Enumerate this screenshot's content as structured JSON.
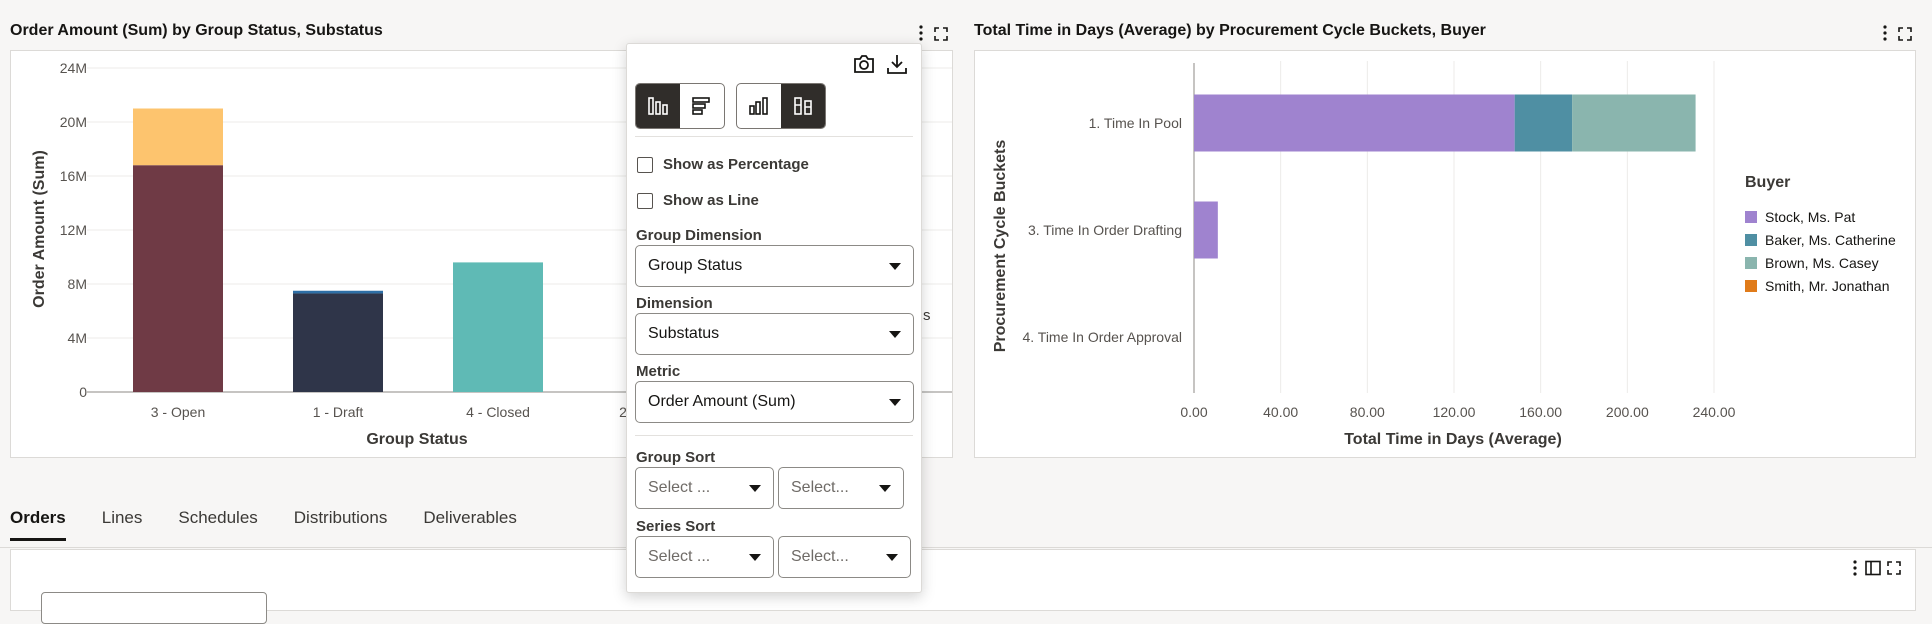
{
  "left_chart": {
    "title": "Order Amount (Sum) by Group Status, Substatus",
    "xlabel": "Group Status",
    "ylabel": "Order Amount (Sum)",
    "yticks": [
      "24M",
      "20M",
      "16M",
      "12M",
      "8M",
      "4M",
      "0"
    ],
    "categories": [
      "3 - Open",
      "1 - Draft",
      "4 - Closed",
      "2"
    ],
    "partial_legend_text": "s"
  },
  "right_chart": {
    "title": "Total Time in Days (Average) by Procurement Cycle Buckets, Buyer",
    "xlabel": "Total Time in Days (Average)",
    "ylabel": "Procurement Cycle Buckets",
    "xticks": [
      "0.00",
      "40.00",
      "80.00",
      "120.00",
      "160.00",
      "200.00",
      "240.00"
    ],
    "categories": [
      "1. Time In Pool",
      "3. Time In Order Drafting",
      "4. Time In Order Approval"
    ],
    "legend_title": "Buyer",
    "legend": [
      {
        "name": "Stock, Ms. Pat",
        "color": "#9f83cf"
      },
      {
        "name": "Baker, Ms. Catherine",
        "color": "#4f8fa3"
      },
      {
        "name": "Brown, Ms. Casey",
        "color": "#8ab5ae"
      },
      {
        "name": "Smith, Mr. Jonathan",
        "color": "#e07b1a"
      }
    ]
  },
  "chart_data": [
    {
      "type": "bar",
      "title": "Order Amount (Sum) by Group Status, Substatus",
      "xlabel": "Group Status",
      "ylabel": "Order Amount (Sum)",
      "ylim": [
        0,
        24000000
      ],
      "categories": [
        "3 - Open",
        "1 - Draft",
        "4 - Closed"
      ],
      "stacked": true,
      "series": [
        {
          "color": "#6f3a45",
          "values": [
            16800000,
            0,
            0
          ]
        },
        {
          "color": "#fdc46e",
          "values": [
            4200000,
            0,
            0
          ]
        },
        {
          "color": "#2f3549",
          "values": [
            0,
            7300000,
            0
          ]
        },
        {
          "color": "#2e6fa6",
          "values": [
            0,
            200000,
            0
          ]
        },
        {
          "color": "#5fbab5",
          "values": [
            0,
            0,
            9600000
          ]
        }
      ]
    },
    {
      "type": "bar",
      "orientation": "horizontal",
      "title": "Total Time in Days (Average) by Procurement Cycle Buckets, Buyer",
      "xlabel": "Total Time in Days (Average)",
      "ylabel": "Procurement Cycle Buckets",
      "xlim": [
        0,
        240
      ],
      "categories": [
        "1. Time In Pool",
        "3. Time In Order Drafting",
        "4. Time In Order Approval"
      ],
      "stacked": true,
      "series": [
        {
          "name": "Stock, Ms. Pat",
          "values": [
            148,
            11,
            0
          ]
        },
        {
          "name": "Baker, Ms. Catherine",
          "values": [
            26.5,
            0,
            0
          ]
        },
        {
          "name": "Brown, Ms. Casey",
          "values": [
            57,
            0,
            0
          ]
        },
        {
          "name": "Smith, Mr. Jonathan",
          "values": [
            0,
            0,
            0
          ]
        }
      ]
    }
  ],
  "popup": {
    "show_percentage": "Show as Percentage",
    "show_line": "Show as Line",
    "group_dimension_label": "Group Dimension",
    "group_dimension_value": "Group Status",
    "dimension_label": "Dimension",
    "dimension_value": "Substatus",
    "metric_label": "Metric",
    "metric_value": "Order Amount (Sum)",
    "group_sort_label": "Group Sort",
    "group_sort_1": "Select ...",
    "group_sort_2": "Select...",
    "series_sort_label": "Series Sort",
    "series_sort_1": "Select ...",
    "series_sort_2": "Select..."
  },
  "tabs": [
    "Orders",
    "Lines",
    "Schedules",
    "Distributions",
    "Deliverables"
  ]
}
